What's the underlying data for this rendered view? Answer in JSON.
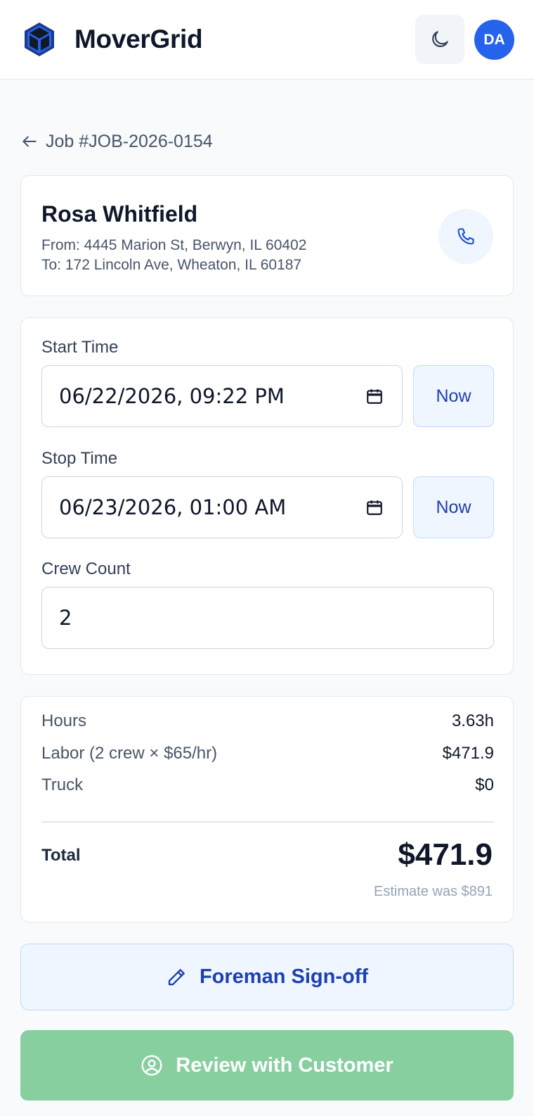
{
  "header": {
    "brand": "MoverGrid",
    "logo_icon": "cube-logo-icon",
    "theme_icon": "moon-icon",
    "avatar_initials": "DA",
    "accent": "#2563eb"
  },
  "back_nav": {
    "icon": "arrow-left-icon",
    "label": "Job #JOB-2026-0154"
  },
  "customer": {
    "name": "Rosa Whitfield",
    "from": "From: 4445 Marion St, Berwyn, IL 60402",
    "to": "To: 172 Lincoln Ave, Wheaton, IL 60187",
    "call_icon": "phone-icon"
  },
  "times": {
    "start_label": "Start Time",
    "start_value": "06/22/2026, 09:22 PM",
    "stop_label": "Stop Time",
    "stop_value": "06/23/2026, 01:00 AM",
    "now_label": "Now",
    "calendar_icon": "calendar-icon",
    "crew_label": "Crew Count",
    "crew_value": "2"
  },
  "totals": {
    "hours_label": "Hours",
    "hours_value": "3.63h",
    "labor_label": "Labor (2 crew × $65/hr)",
    "labor_value": "$471.9",
    "truck_label": "Truck",
    "truck_value": "$0",
    "total_label": "Total",
    "total_value": "$471.9",
    "estimate_note": "Estimate was $891"
  },
  "actions": {
    "signoff_label": "Foreman Sign-off",
    "signoff_icon": "pencil-icon",
    "review_label": "Review with Customer",
    "review_icon": "user-circle-icon",
    "review_color": "#88cfa0"
  }
}
